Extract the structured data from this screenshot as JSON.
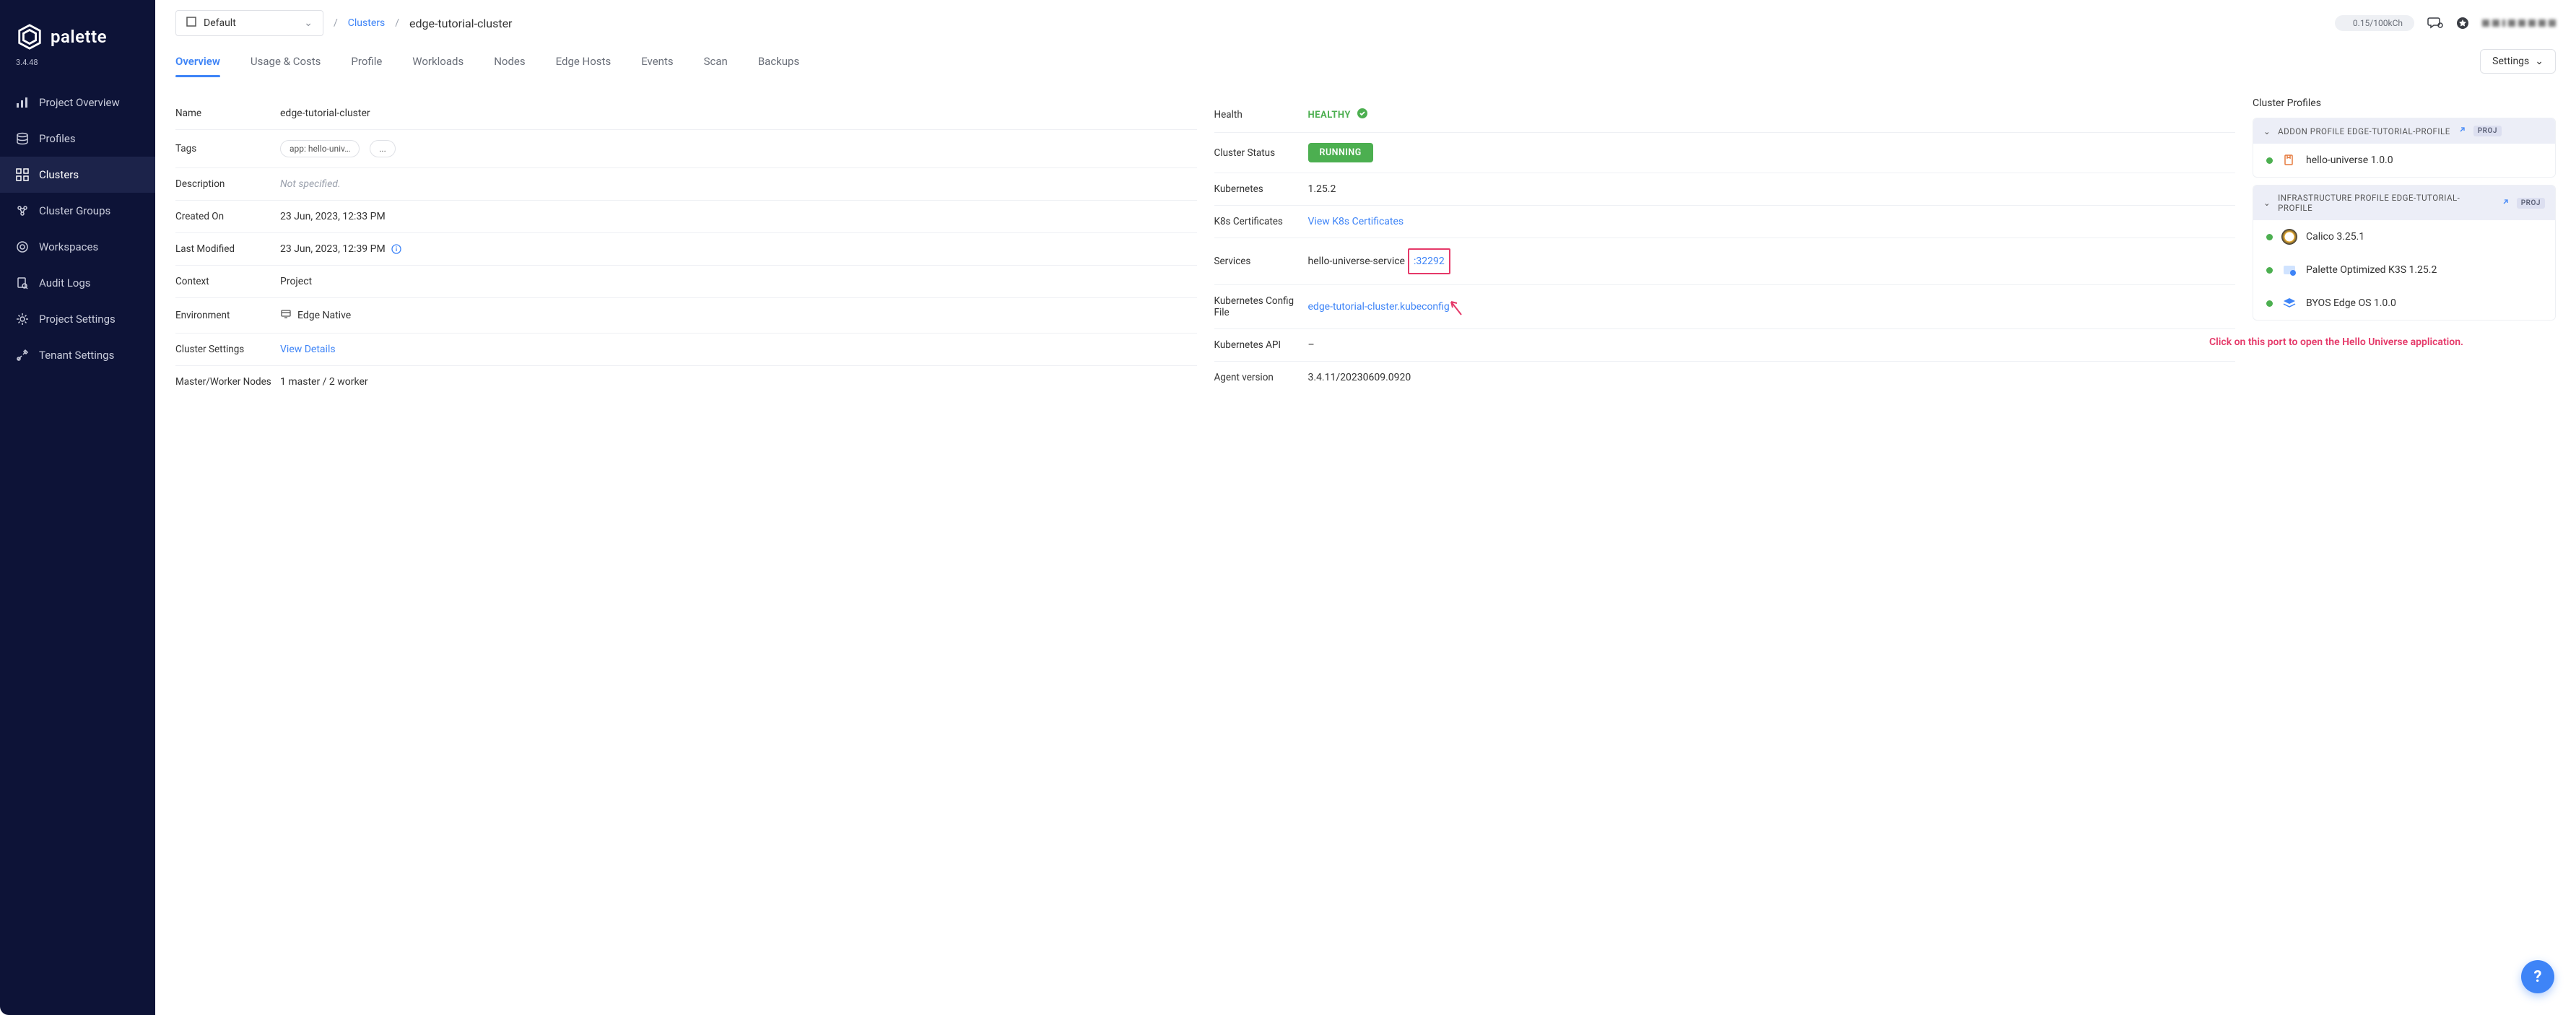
{
  "brand": {
    "name": "palette",
    "version": "3.4.48"
  },
  "sidebar": {
    "items": [
      {
        "label": "Project Overview"
      },
      {
        "label": "Profiles"
      },
      {
        "label": "Clusters"
      },
      {
        "label": "Cluster Groups"
      },
      {
        "label": "Workspaces"
      },
      {
        "label": "Audit Logs"
      },
      {
        "label": "Project Settings"
      },
      {
        "label": "Tenant Settings"
      }
    ],
    "active_index": 2
  },
  "header": {
    "scope": "Default",
    "breadcrumb_link": "Clusters",
    "breadcrumb_current": "edge-tutorial-cluster",
    "usage": "0.15/100kCh"
  },
  "tabs": {
    "items": [
      {
        "label": "Overview"
      },
      {
        "label": "Usage & Costs"
      },
      {
        "label": "Profile"
      },
      {
        "label": "Workloads"
      },
      {
        "label": "Nodes"
      },
      {
        "label": "Edge Hosts"
      },
      {
        "label": "Events"
      },
      {
        "label": "Scan"
      },
      {
        "label": "Backups"
      }
    ],
    "active_index": 0,
    "settings_label": "Settings"
  },
  "details_left": {
    "name": {
      "label": "Name",
      "value": "edge-tutorial-cluster"
    },
    "tags": {
      "label": "Tags",
      "chip": "app: hello-univ…",
      "more": "..."
    },
    "description": {
      "label": "Description",
      "value": "Not specified."
    },
    "created": {
      "label": "Created On",
      "value": "23 Jun, 2023, 12:33 PM"
    },
    "modified": {
      "label": "Last Modified",
      "value": "23 Jun, 2023, 12:39 PM"
    },
    "context": {
      "label": "Context",
      "value": "Project"
    },
    "environment": {
      "label": "Environment",
      "value": "Edge Native"
    },
    "cluster_settings": {
      "label": "Cluster Settings",
      "value": "View Details"
    },
    "nodes": {
      "label": "Master/Worker Nodes",
      "value": "1 master / 2 worker"
    }
  },
  "details_mid": {
    "health": {
      "label": "Health",
      "value": "HEALTHY"
    },
    "status": {
      "label": "Cluster Status",
      "value": "RUNNING"
    },
    "kubernetes": {
      "label": "Kubernetes",
      "value": "1.25.2"
    },
    "k8s_certs": {
      "label": "K8s Certificates",
      "value": "View K8s Certificates"
    },
    "services": {
      "label": "Services",
      "name": "hello-universe-service",
      "port": ":32292"
    },
    "config_file": {
      "label": "Kubernetes Config File",
      "value": "edge-tutorial-cluster.kubeconfig"
    },
    "k8s_api": {
      "label": "Kubernetes API",
      "value": "–"
    },
    "agent": {
      "label": "Agent version",
      "value": "3.4.11/20230609.0920"
    }
  },
  "profiles": {
    "title": "Cluster Profiles",
    "addon_header": "ADDON PROFILE EDGE-TUTORIAL-PROFILE",
    "addon_badge": "PROJ",
    "addon_items": [
      {
        "name": "hello-universe 1.0.0"
      }
    ],
    "infra_header": "INFRASTRUCTURE PROFILE EDGE-TUTORIAL-PROFILE",
    "infra_badge": "PROJ",
    "infra_items": [
      {
        "name": "Calico 3.25.1"
      },
      {
        "name": "Palette Optimized K3S 1.25.2"
      },
      {
        "name": "BYOS Edge OS 1.0.0"
      }
    ]
  },
  "annotation": "Click on this port to open the Hello Universe application.",
  "help": "?"
}
